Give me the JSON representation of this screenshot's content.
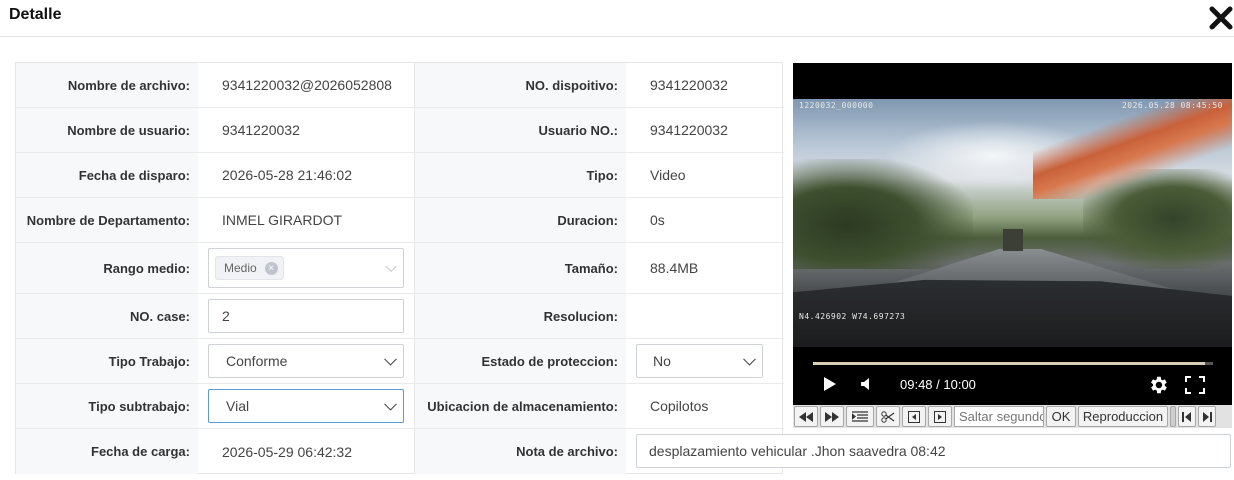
{
  "header": {
    "title": "Detalle"
  },
  "form": {
    "rows": [
      {
        "label1": "Nombre de archivo:",
        "value1": "9341220032@2026052808",
        "label2": "NO. dispoitivo:",
        "value2": "9341220032"
      },
      {
        "label1": "Nombre de usuario:",
        "value1": "9341220032",
        "label2": "Usuario NO.:",
        "value2": "9341220032"
      },
      {
        "label1": "Fecha de disparo:",
        "value1": "2026-05-28 21:46:02",
        "label2": "Tipo:",
        "value2": "Video"
      },
      {
        "label1": "Nombre de Departamento:",
        "value1": "INMEL GIRARDOT",
        "label2": "Duracion:",
        "value2": "0s"
      },
      {
        "label1": "Rango medio:",
        "tag": "Medio",
        "label2": "Tamaño:",
        "value2": "88.4MB"
      },
      {
        "label1": "NO. case:",
        "input_value": "2",
        "label2": "Resolucion:",
        "value2": ""
      },
      {
        "label1": "Tipo Trabajo:",
        "select_value": "Conforme",
        "label2": "Estado de proteccion:",
        "select2_value": "No"
      },
      {
        "label1": "Tipo subtrabajo:",
        "select_value": "Vial",
        "label2": "Ubicacion de almacenamiento:",
        "value2": "Copilotos"
      },
      {
        "label1": "Fecha de carga:",
        "value1": "2026-05-29 06:42:32",
        "label2": "Nota de archivo:",
        "note_value": "desplazamiento vehicular .Jhon saavedra 08:42"
      }
    ]
  },
  "player": {
    "osd_top_left": "1220032_000000",
    "osd_top_right": "2026.05.28 08:45:50",
    "osd_coords": "N4.426902 W74.697273",
    "time": "09:48 / 10:00",
    "progress": 0.98
  },
  "toolbar": {
    "skip_placeholder": "Saltar segundos",
    "ok_label": "OK",
    "playback_label": "Reproduccion"
  }
}
